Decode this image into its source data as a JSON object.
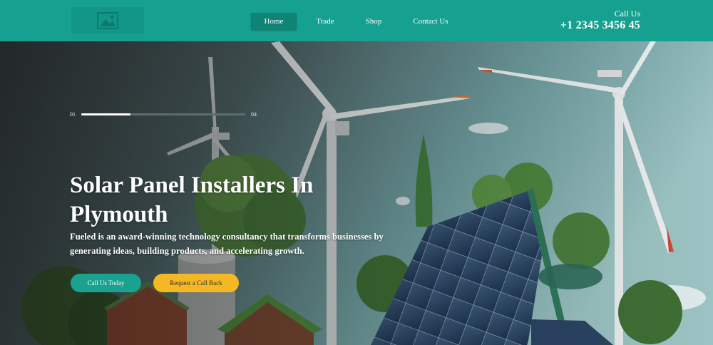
{
  "header": {
    "logo_icon": "image-placeholder-icon",
    "nav": [
      {
        "label": "Home"
      },
      {
        "label": "Trade"
      },
      {
        "label": "Shop"
      },
      {
        "label": "Contact Us"
      }
    ],
    "call_label": "Call Us",
    "phone": "+1 2345 3456 45"
  },
  "hero": {
    "slider": {
      "current": "01",
      "total": "04",
      "progress": 0.3
    },
    "title": "Solar Panel Installers In Plymouth",
    "description": "Fueled is an award-winning technology consultancy that transforms businesses by generating ideas, building products, and accelerating growth.",
    "primary_button": "Call Us Today",
    "secondary_button": "Request a Call Back"
  },
  "colors": {
    "header_bg": "#16a08f",
    "primary_button": "#1aa18f",
    "secondary_button": "#f4b825"
  }
}
